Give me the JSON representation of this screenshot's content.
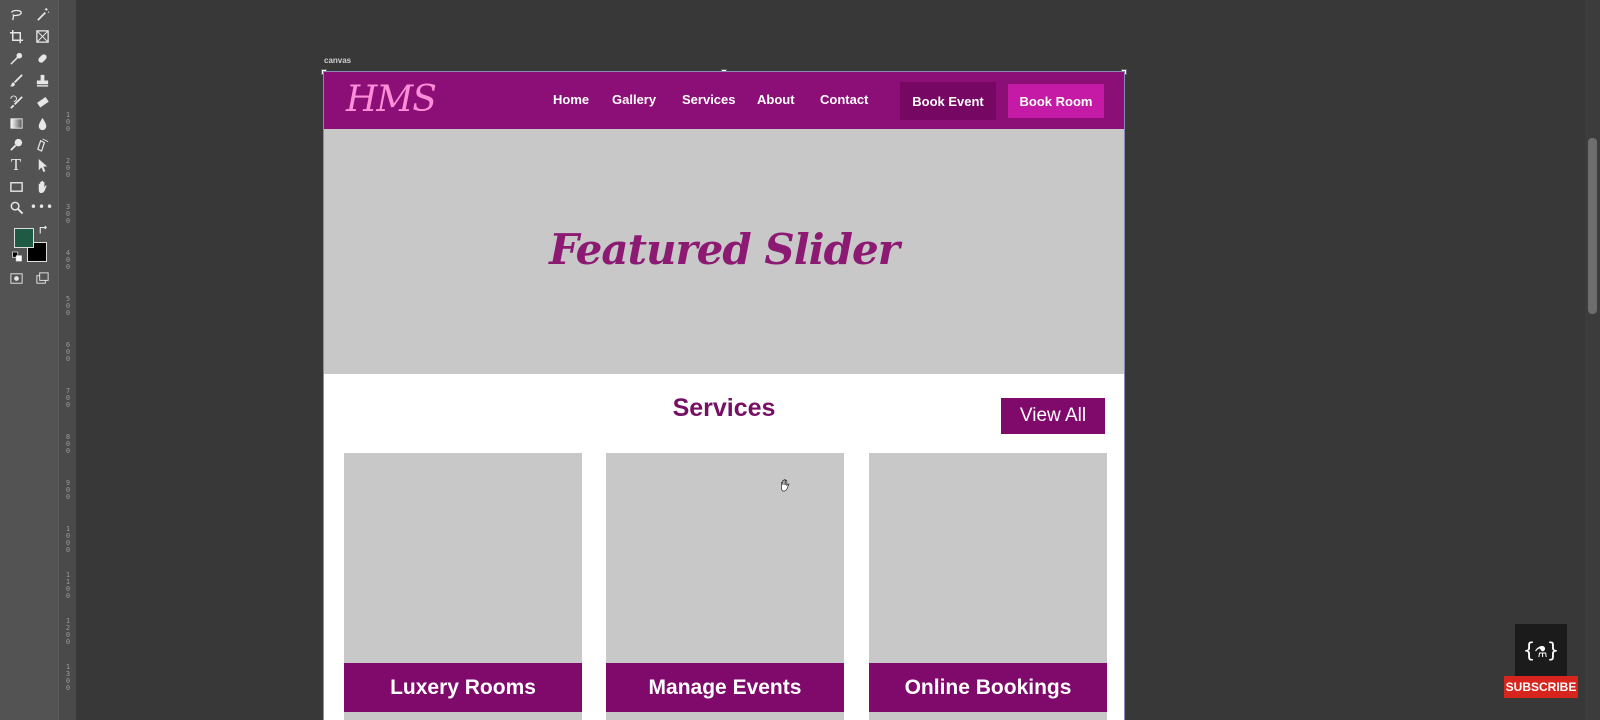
{
  "editor": {
    "artboard_label": "canvas",
    "ruler_ticks": [
      "1\n0\n0",
      "2\n0\n0",
      "3\n0\n0",
      "4\n0\n0",
      "5\n0\n0",
      "6\n0\n0",
      "7\n0\n0",
      "8\n0\n0",
      "9\n0\n0",
      "1\n0\n0\n0",
      "1\n1\n0\n0",
      "1\n2\n0\n0",
      "1\n3\n0\n0"
    ],
    "foreground_color": "#1f5a45",
    "background_color": "#000000",
    "tools": [
      "lasso-icon",
      "magic-wand-icon",
      "crop-icon",
      "frame-icon",
      "eyedropper-icon",
      "healing-brush-icon",
      "brush-icon",
      "stamp-icon",
      "history-brush-icon",
      "eraser-icon",
      "gradient-icon",
      "blur-icon",
      "dodge-icon",
      "pen-icon",
      "type-icon",
      "path-select-icon",
      "rectangle-icon",
      "hand-icon",
      "zoom-icon",
      "more-icon"
    ]
  },
  "site": {
    "logo": "HMS",
    "nav": [
      "Home",
      "Gallery",
      "Services",
      "About",
      "Contact"
    ],
    "book_event": "Book Event",
    "book_room": "Book Room",
    "hero_title": "Featured Slider",
    "services_title": "Services",
    "view_all": "View All",
    "cards": [
      "Luxery Rooms",
      "Manage Events",
      "Online Bookings"
    ],
    "colors": {
      "primary": "#8c0e77",
      "accent": "#c41aa6",
      "placeholder_gray": "#c8c8c8"
    }
  },
  "overlay": {
    "channel_logo": "{⚗}",
    "subscribe": "SUBSCRIBE"
  }
}
